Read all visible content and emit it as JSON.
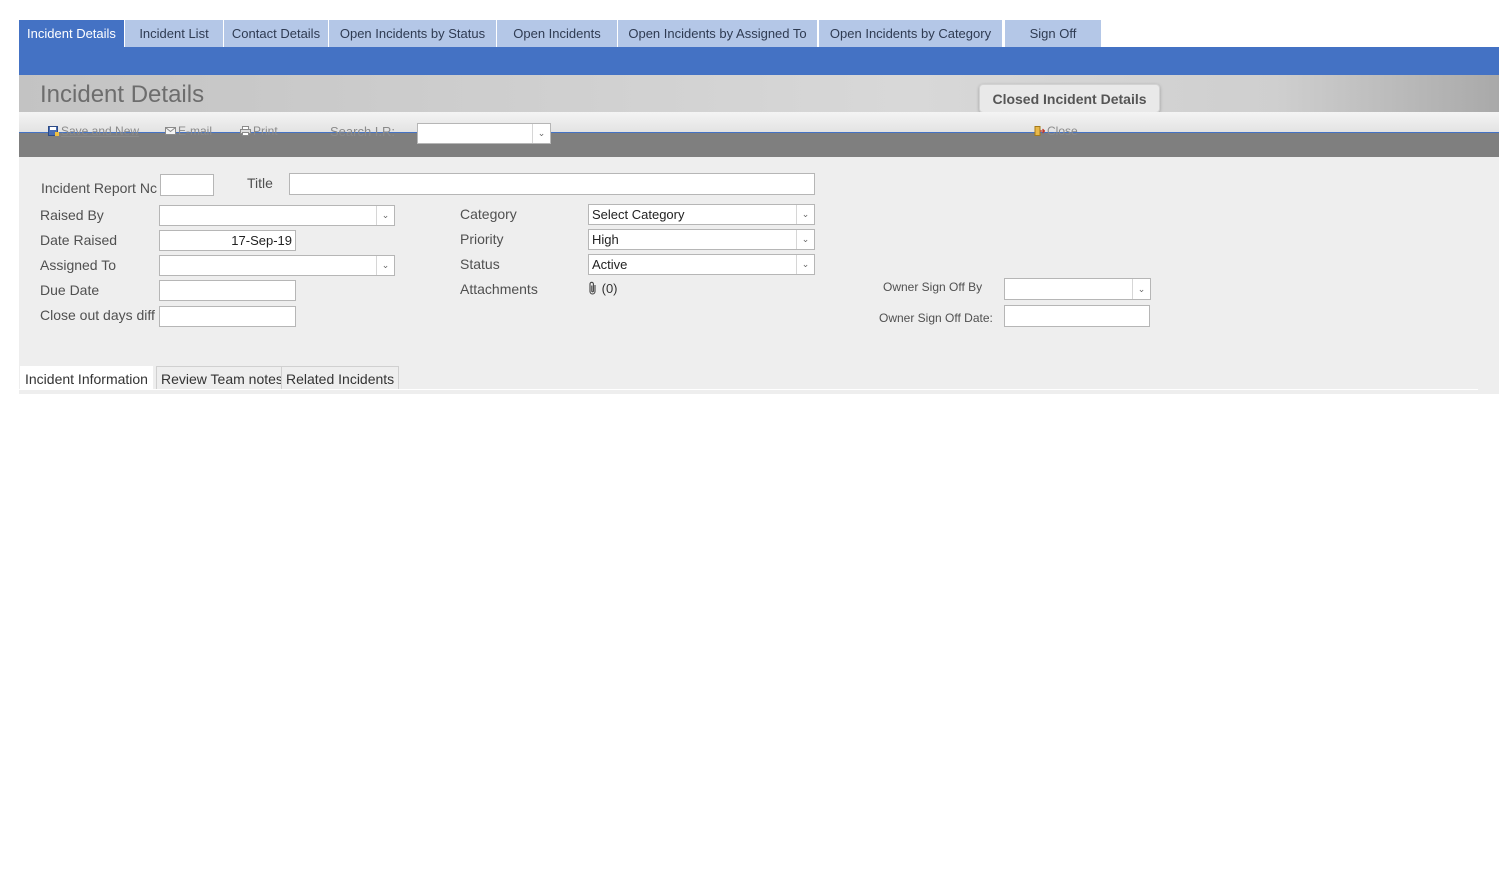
{
  "tabs": [
    {
      "label": "Incident Details",
      "active": true
    },
    {
      "label": "Incident List"
    },
    {
      "label": "Contact Details"
    },
    {
      "label": "Open Incidents by Status"
    },
    {
      "label": "Open Incidents"
    },
    {
      "label": "Open Incidents by Assigned To"
    },
    {
      "label": "Open Incidents by Category"
    },
    {
      "label": "Sign Off"
    }
  ],
  "header": {
    "title": "Incident Details",
    "closed_button": "Closed Incident Details"
  },
  "toolbar": {
    "save_new": "Save and New",
    "email": "E-mail",
    "print": "Print",
    "search_label": "Search I.R:",
    "search_value": "",
    "close": "Close"
  },
  "form": {
    "incident_report_no": {
      "label": "Incident Report Nc",
      "value": ""
    },
    "title": {
      "label": "Title",
      "value": ""
    },
    "raised_by": {
      "label": "Raised By",
      "value": ""
    },
    "date_raised": {
      "label": "Date Raised",
      "value": "17-Sep-19"
    },
    "assigned_to": {
      "label": "Assigned To",
      "value": ""
    },
    "due_date": {
      "label": "Due Date",
      "value": ""
    },
    "close_out_days": {
      "label": "Close out days diff",
      "value": ""
    },
    "category": {
      "label": "Category",
      "value": "Select Category"
    },
    "priority": {
      "label": "Priority",
      "value": "High"
    },
    "status": {
      "label": "Status",
      "value": "Active"
    },
    "attachments": {
      "label": "Attachments",
      "value": "(0)"
    },
    "owner_sign_off_by": {
      "label": "Owner Sign Off By",
      "value": ""
    },
    "owner_sign_off_date": {
      "label": "Owner Sign Off Date:",
      "value": ""
    }
  },
  "subtabs": [
    {
      "label": "Incident Information",
      "active": true
    },
    {
      "label": "Review Team notes"
    },
    {
      "label": "Related Incidents"
    }
  ],
  "colors": {
    "accent_blue": "#4472c4",
    "inactive_tab": "#b4c7e7",
    "form_background": "#eeeeee"
  }
}
